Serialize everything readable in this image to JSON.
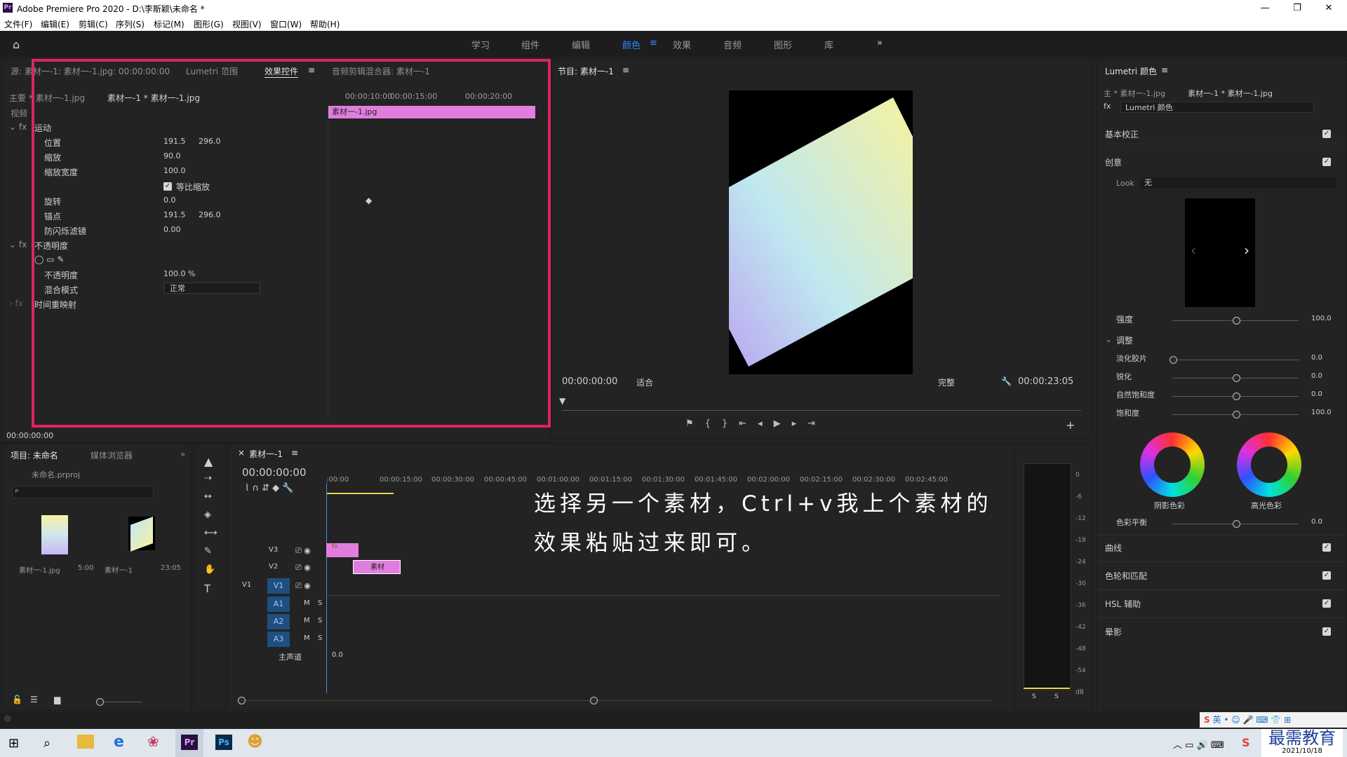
{
  "window": {
    "title": "Adobe Premiere Pro 2020 - D:\\李斯颖\\未命名 *",
    "min": "—",
    "max": "❐",
    "close": "✕"
  },
  "menu": [
    "文件(F)",
    "编辑(E)",
    "剪辑(C)",
    "序列(S)",
    "标记(M)",
    "图形(G)",
    "视图(V)",
    "窗口(W)",
    "帮助(H)"
  ],
  "workspaces": {
    "items": [
      "学习",
      "组件",
      "编辑",
      "颜色",
      "效果",
      "音频",
      "图形",
      "库"
    ],
    "active": "颜色",
    "more": "»"
  },
  "effect_controls": {
    "tabs": [
      "源: 素材一-1: 素材一-1.jpg: 00:00:00:00",
      "Lumetri 范围",
      "效果控件",
      "音频剪辑混合器: 素材一-1"
    ],
    "menu_icon": "≡",
    "master_label": "主要 * 素材一-1.jpg",
    "seq_label": "素材一-1 * 素材一-1.jpg",
    "ruler": [
      "00:00:10:00",
      "00:00:15:00",
      "00:00:20:00"
    ],
    "clip_name": "素材一-1.jpg",
    "video_label": "视频",
    "motion": "运动",
    "position": {
      "label": "位置",
      "x": "191.5",
      "y": "296.0"
    },
    "scale": {
      "label": "缩放",
      "value": "90.0"
    },
    "scale_width": {
      "label": "缩放宽度",
      "value": "100.0"
    },
    "uniform": "等比缩放",
    "rotation": {
      "label": "旋转",
      "value": "0.0"
    },
    "anchor": {
      "label": "锚点",
      "x": "191.5",
      "y": "296.0"
    },
    "flicker": {
      "label": "防闪烁滤镜",
      "value": "0.00"
    },
    "opacity_group": "不透明度",
    "opacity": {
      "label": "不透明度",
      "value": "100.0 %"
    },
    "blend": {
      "label": "混合模式",
      "value": "正常"
    },
    "time_remap": "时间重映射",
    "timecode": "00:00:00:00"
  },
  "program": {
    "title": "节目: 素材一-1",
    "timecode": "00:00:00:00",
    "fit": "适合",
    "quality": "完整",
    "duration": "00:00:23:05"
  },
  "project": {
    "tabs": [
      "项目: 未命名",
      "媒体浏览器"
    ],
    "file": "未命名.prproj",
    "items": [
      {
        "name": "素材一-1.jpg",
        "dur": "5:00"
      },
      {
        "name": "素材一-1",
        "dur": "23:05"
      }
    ]
  },
  "timeline": {
    "tab": "素材一-1",
    "timecode": "00:00:00:00",
    "ruler": [
      ":00:00",
      "00:00:15:00",
      "00:00:30:00",
      "00:00:45:00",
      "00:01:00:00",
      "00:01:15:00",
      "00:01:30:00",
      "00:01:45:00",
      "00:02:00:00",
      "00:02:15:00",
      "00:02:30:00",
      "00:02:45:00"
    ],
    "tracks": [
      {
        "id": "V3",
        "type": "video"
      },
      {
        "id": "V2",
        "type": "video"
      },
      {
        "id": "V1",
        "type": "video",
        "src": "V1"
      },
      {
        "id": "A1",
        "type": "audio"
      },
      {
        "id": "A2",
        "type": "audio"
      },
      {
        "id": "A3",
        "type": "audio"
      }
    ],
    "master": {
      "label": "主声道",
      "value": "0.0"
    },
    "clip_v3": "fx",
    "clip_v2": "素材",
    "mute": "M",
    "solo": "S"
  },
  "caption": {
    "line1": "选择另一个素材，Ctrl+v我上个素材的",
    "line2": "效果粘贴过来即可。"
  },
  "meter": {
    "ticks": [
      "0",
      "-6",
      "-12",
      "-18",
      "-24",
      "-30",
      "-36",
      "-42",
      "-48",
      "-54",
      "dB"
    ],
    "s": "S"
  },
  "lumetri": {
    "title": "Lumetri 颜色",
    "master": "主 * 素材一-1.jpg",
    "seq": "素材一-1 * 素材一-1.jpg",
    "fx_name": "Lumetri 颜色",
    "sections": [
      "基本校正",
      "创意",
      "曲线",
      "色轮和匹配",
      "HSL 辅助",
      "晕影"
    ],
    "look_label": "Look",
    "look_value": "无",
    "intensity": {
      "label": "强度",
      "value": "100.0"
    },
    "adjust": "调整",
    "faded": {
      "label": "淡化胶片",
      "value": "0.0"
    },
    "sharpen": {
      "label": "锐化",
      "value": "0.0"
    },
    "vibrance": {
      "label": "自然饱和度",
      "value": "0.0"
    },
    "saturation": {
      "label": "饱和度",
      "value": "100.0"
    },
    "shadow_tint": "阴影色彩",
    "highlight_tint": "高光色彩",
    "tint_balance": {
      "label": "色彩平衡",
      "value": "0.0"
    }
  },
  "watermark": "最需教育",
  "tray": {
    "ime": "英",
    "date": "2021/10/18"
  }
}
